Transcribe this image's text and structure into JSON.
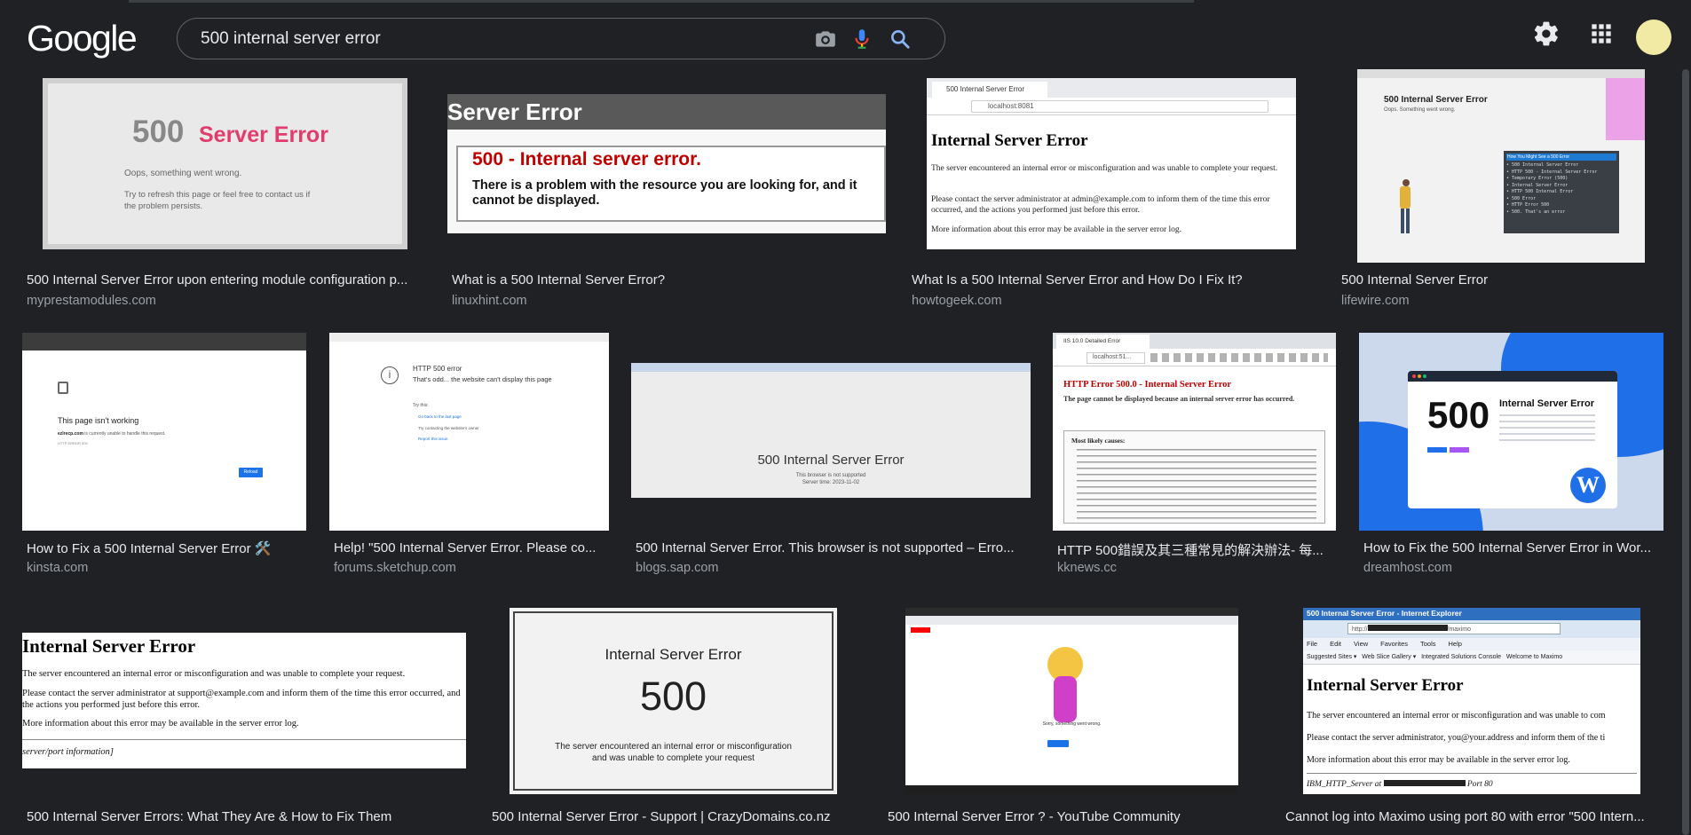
{
  "header": {
    "logo": "Google",
    "search_value": "500 internal server error"
  },
  "results": [
    {
      "title": "500 Internal Server Error upon entering module configuration p...",
      "source": "myprestamodules.com",
      "thumb": {
        "big": "500",
        "word": "Server Error",
        "line1": "Oops, something went wrong.",
        "line2": "Try to refresh this page or feel free to contact us if",
        "line3": "the problem persists."
      }
    },
    {
      "title": "What is a 500 Internal Server Error?",
      "source": "linuxhint.com",
      "thumb": {
        "header": "Server Error",
        "heading": "500 - Internal server error.",
        "body": "There is a problem with the resource you are looking for, and it cannot be displayed."
      }
    },
    {
      "title": "What Is a 500 Internal Server Error and How Do I Fix It?",
      "source": "howtogeek.com",
      "thumb": {
        "tab": "500 Internal Server Error",
        "url": "localhost:8081",
        "heading": "Internal Server Error",
        "p1": "The server encountered an internal error or misconfiguration and was unable to complete your request.",
        "p2": "Please contact the server administrator at admin@example.com to inform them of the time this error occurred, and the actions you performed just before this error.",
        "p3": "More information about this error may be available in the server error log."
      }
    },
    {
      "title": "500 Internal Server Error",
      "source": "lifewire.com",
      "thumb": {
        "heading": "500 Internal Server Error",
        "sub": "Oops. Something went wrong.",
        "panel_title": "How You Might See a 500 Error",
        "items": [
          "500 Internal Server Error",
          "HTTP 500 - Internal Server Error",
          "Temporary Error (500)",
          "Internal Server Error",
          "HTTP 500 Internal Error",
          "500 Error",
          "HTTP Error 500",
          "500. That's an error"
        ]
      }
    },
    {
      "title": "How to Fix a 500 Internal Server Error 🛠️",
      "source": "kinsta.com",
      "thumb": {
        "heading": "This page isn't working",
        "line": "is currently unable to handle this request.",
        "code": "HTTP ERROR 500",
        "button": "Reload"
      }
    },
    {
      "title": "Help! \"500 Internal Server Error. Please co...",
      "source": "forums.sketchup.com",
      "thumb": {
        "heading": "HTTP 500 error",
        "sub": "That's odd... the website can't display this page",
        "try": "Try this:",
        "l1": "Go back to the last page",
        "l2": "Try contacting the website's owner",
        "l3": "Report this issue"
      }
    },
    {
      "title": "500 Internal Server Error. This browser is not supported – Erro...",
      "source": "blogs.sap.com",
      "thumb": {
        "heading": "500 Internal Server Error",
        "l1": "This browser is not supported",
        "l2": "Server time: 2023-11-02"
      }
    },
    {
      "title": "HTTP 500錯誤及其三種常見的解決辦法- 每...",
      "source": "kknews.cc",
      "thumb": {
        "tab": "IIS 10.0 Detailed Error",
        "url": "localhost:51...",
        "heading": "HTTP Error 500.0 - Internal Server Error",
        "sub": "The page cannot be displayed because an internal server error has occurred.",
        "box_title": "Most likely causes:"
      }
    },
    {
      "title": "How to Fix the 500 Internal Server Error in Wor...",
      "source": "dreamhost.com",
      "thumb": {
        "big": "500",
        "label": "Internal Server Error"
      }
    },
    {
      "title": "500 Internal Server Errors: What They Are & How to Fix Them",
      "source": "",
      "thumb": {
        "heading": "Internal Server Error",
        "p1": "The server encountered an internal error or misconfiguration and was unable to complete your request.",
        "p2": "Please contact the server administrator at support@example.com and inform them of the time this error occurred, and the actions you performed just before this error.",
        "p3": "More information about this error may be available in the server error log.",
        "footer": "server/port information]"
      }
    },
    {
      "title": "500 Internal Server Error - Support | CrazyDomains.co.nz",
      "source": "",
      "thumb": {
        "heading": "Internal Server Error",
        "big": "500",
        "l1": "The server encountered an internal error or misconfiguration",
        "l2": "and was unable to complete your request"
      }
    },
    {
      "title": "500 Internal Server Error ? - YouTube Community",
      "source": "",
      "thumb": {
        "msg": "Sorry, something went wrong."
      }
    },
    {
      "title": "Cannot log into Maximo using port 80 with error \"500 Intern...",
      "source": "",
      "thumb": {
        "window": "500 Internal Server Error - Internet Explorer",
        "menu": [
          "File",
          "Edit",
          "View",
          "Favorites",
          "Tools",
          "Help"
        ],
        "fav1": "Suggested Sites",
        "fav2": "Web Slice Gallery",
        "fav3": "Integrated Solutions Console",
        "fav4": "Welcome to Maximo",
        "heading": "Internal Server Error",
        "p1": "The server encountered an internal error or misconfiguration and was unable to com",
        "p2": "Please contact the server administrator, you@your.address and inform them of the ti",
        "p3": "More information about this error may be available in the server error log.",
        "footer_a": "IBM_HTTP_Server at",
        "footer_b": "Port 80"
      }
    }
  ],
  "colors": {
    "bg": "#202124",
    "accent_red": "#e23c6f",
    "error_red": "#c00000",
    "link_blue": "#1a73e8"
  }
}
